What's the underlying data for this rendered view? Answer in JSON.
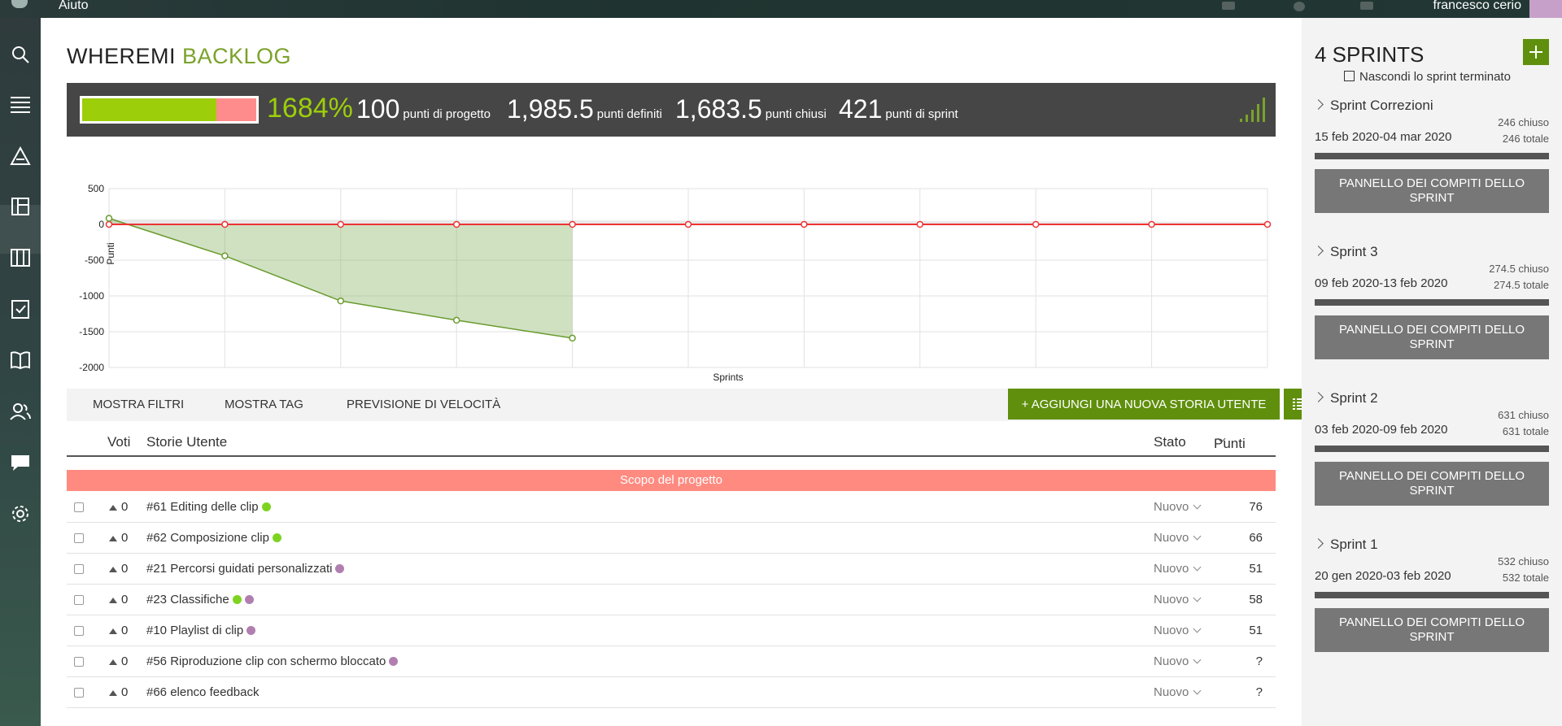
{
  "topbar": {
    "help_label": "Aiuto",
    "user_name": "francesco cerio"
  },
  "sidebar": {
    "items": [
      {
        "icon": "search-icon"
      },
      {
        "icon": "menu-icon"
      },
      {
        "icon": "epics-icon"
      },
      {
        "icon": "backlog-icon"
      },
      {
        "icon": "kanban-icon"
      },
      {
        "icon": "issues-icon"
      },
      {
        "icon": "wiki-icon"
      },
      {
        "icon": "team-icon"
      },
      {
        "icon": "chat-icon"
      },
      {
        "icon": "settings-icon"
      }
    ]
  },
  "header": {
    "title_main": "WHEREMI",
    "title_accent": "BACKLOG"
  },
  "stats": {
    "percent": "1684%",
    "progress_fraction": 0.77,
    "project_points_value": "100",
    "project_points_label": "punti di progetto",
    "defined_points_value": "1,985.5",
    "defined_points_label": "punti definiti",
    "closed_points_value": "1,683.5",
    "closed_points_label": "punti chiusi",
    "sprint_points_value": "421",
    "sprint_points_label": "punti di sprint"
  },
  "colors": {
    "accent": "#7aa22a",
    "button_green": "#5f8f0c",
    "progress_green": "#9dce0a",
    "scope_red": "#ff8a80",
    "dot_green": "#7ed321",
    "dot_purple": "#b07fb0"
  },
  "chart_data": {
    "type": "line",
    "xlabel": "Sprints",
    "ylabel": "Punti",
    "ylim": [
      -2000,
      500
    ],
    "yticks": [
      "500",
      "0",
      "-500",
      "-1000",
      "-1500",
      "-2000"
    ],
    "x": [
      0,
      1,
      2,
      3,
      4,
      5,
      6,
      7,
      8,
      9,
      10
    ],
    "series": [
      {
        "color": "#e33",
        "values": [
          0,
          0,
          0,
          0,
          0,
          0,
          0,
          0,
          0,
          0,
          0
        ]
      },
      {
        "color": "#6a9b2e",
        "values": [
          85,
          -440,
          -1070,
          -1340,
          -1590
        ]
      }
    ],
    "grid": true
  },
  "filters": {
    "show_filters": "MOSTRA FILTRI",
    "show_tags": "MOSTRA TAG",
    "velocity": "PREVISIONE DI VELOCITÀ",
    "add_story": "+ AGGIUNGI UNA NUOVA STORIA UTENTE"
  },
  "table": {
    "col_votes": "Voti",
    "col_story": "Storie Utente",
    "col_status": "Stato",
    "col_points": "Punti",
    "scope_label": "Scopo del progetto",
    "rows": [
      {
        "votes": "0",
        "subject": "#61 Editing delle clip",
        "tags": [
          "green"
        ],
        "status": "Nuovo",
        "points": "76"
      },
      {
        "votes": "0",
        "subject": "#62 Composizione clip",
        "tags": [
          "green"
        ],
        "status": "Nuovo",
        "points": "66"
      },
      {
        "votes": "0",
        "subject": "#21 Percorsi guidati personalizzati",
        "tags": [
          "purple"
        ],
        "status": "Nuovo",
        "points": "51"
      },
      {
        "votes": "0",
        "subject": "#23 Classifiche",
        "tags": [
          "green",
          "purple"
        ],
        "status": "Nuovo",
        "points": "58"
      },
      {
        "votes": "0",
        "subject": "#10 Playlist di clip",
        "tags": [
          "purple"
        ],
        "status": "Nuovo",
        "points": "51"
      },
      {
        "votes": "0",
        "subject": "#56 Riproduzione clip con schermo bloccato",
        "tags": [
          "purple"
        ],
        "status": "Nuovo",
        "points": "?"
      },
      {
        "votes": "0",
        "subject": "#66 elenco feedback",
        "tags": [],
        "status": "Nuovo",
        "points": "?"
      }
    ]
  },
  "sprints": {
    "title": "4 SPRINTS",
    "hide_label": "Nascondi lo sprint terminato",
    "button_label": "PANNELLO DEI COMPITI DELLO SPRINT",
    "items": [
      {
        "name": "Sprint Correzioni",
        "closed": "246 chiuso",
        "dates": "15 feb 2020-04 mar 2020",
        "total": "246 totale"
      },
      {
        "name": "Sprint 3",
        "closed": "274.5 chiuso",
        "dates": "09 feb 2020-13 feb 2020",
        "total": "274.5 totale"
      },
      {
        "name": "Sprint 2",
        "closed": "631 chiuso",
        "dates": "03 feb 2020-09 feb 2020",
        "total": "631 totale"
      },
      {
        "name": "Sprint 1",
        "closed": "532 chiuso",
        "dates": "20 gen 2020-03 feb 2020",
        "total": "532 totale"
      }
    ]
  }
}
